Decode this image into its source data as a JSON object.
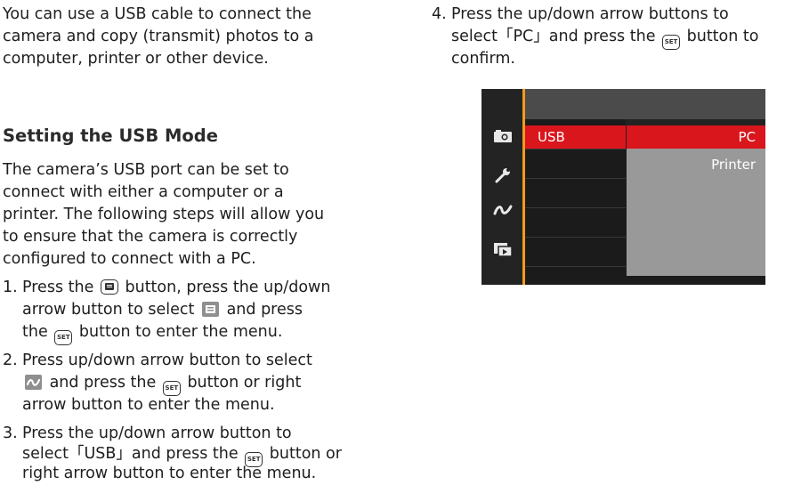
{
  "intro": [
    "You can use a USB cable to connect the",
    "camera and copy (transmit) photos to a",
    "computer, printer or other device."
  ],
  "heading": "Setting the USB Mode",
  "description": [
    "The camera’s USB port can be set to",
    "connect with either a computer or a",
    "printer. The following steps will allow you",
    "to ensure that the camera is correctly",
    "configured to connect with a PC."
  ],
  "steps": {
    "s1": {
      "num": "1.",
      "a": "Press the",
      "b": "button, press the up/down",
      "c": "arrow button to select",
      "d": "and press",
      "e": "the",
      "f": "button to enter the menu."
    },
    "s2": {
      "num": "2.",
      "a": "Press up/down arrow button to select",
      "b": "and press the",
      "c": "button or right",
      "d": "arrow button to enter the menu."
    },
    "s3": {
      "num": "3.",
      "a": "Press the up/down arrow button to",
      "b": "select「USB」and press the",
      "c": "button or",
      "d": "right arrow button to enter the menu."
    },
    "s4": {
      "num": "4.",
      "a": "Press the up/down arrow buttons to",
      "b": "select「PC」and press the",
      "c": "button to",
      "d": "confirm."
    }
  },
  "keys": {
    "set": "SET"
  },
  "icons": {
    "menu_key": "menu-button-icon",
    "setup_tab": "setup-menu-icon",
    "connection": "connection-menu-icon",
    "camera": "camera-icon",
    "wrench": "wrench-icon",
    "playback": "playback-icon"
  },
  "screen": {
    "menu_item": "USB",
    "options": [
      "PC",
      "Printer"
    ],
    "colors": {
      "highlight": "#d9161c",
      "accent": "#f39a1d",
      "panel": "#999999"
    }
  }
}
